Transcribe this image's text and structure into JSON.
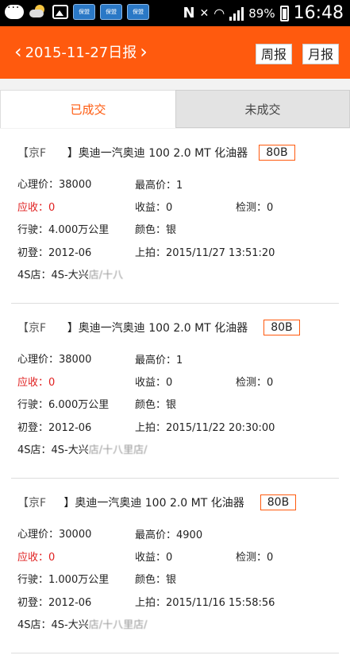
{
  "statusbar": {
    "battery": "89%",
    "time": "16:48",
    "apps": [
      "保盟",
      "保盟",
      "保盟"
    ]
  },
  "header": {
    "date": "2015-11-27日报",
    "weekly_label": "周报",
    "monthly_label": "月报"
  },
  "tabs": {
    "done": "已成交",
    "not_done": "未成交"
  },
  "cards": [
    {
      "plate": "【京F",
      "plate_tail": "】",
      "model": "奥迪一汽奥迪 100 2.0 MT 化油器",
      "badge": "80B",
      "psy_price": "心理价：38000",
      "max_price": "最高价：1",
      "receivable": "应收：0",
      "profit": "收益：0",
      "inspect": "检测：0",
      "mileage": "行驶：4.000万公里",
      "color": "颜色：银",
      "first_reg": "初登：2012-06",
      "auction": "上拍：2015/11/27 13:51:20",
      "store": "4S店：4S-大兴",
      "store_tail": "店/十八"
    },
    {
      "plate": "【京F",
      "plate_tail": "】",
      "model": "奥迪一汽奥迪 100 2.0 MT 化油器",
      "badge": "80B",
      "psy_price": "心理价：38000",
      "max_price": "最高价：1",
      "receivable": "应收：0",
      "profit": "收益：0",
      "inspect": "检测：0",
      "mileage": "行驶：6.000万公里",
      "color": "颜色：银",
      "first_reg": "初登：2012-06",
      "auction": "上拍：2015/11/22 20:30:00",
      "store": "4S店：4S-大兴",
      "store_tail": "店/十八里店/"
    },
    {
      "plate": "【京F",
      "plate_tail": "】",
      "model": "奥迪一汽奥迪 100 2.0 MT 化油器",
      "badge": "80B",
      "psy_price": "心理价：30000",
      "max_price": "最高价：4900",
      "receivable": "应收：0",
      "profit": "收益：0",
      "inspect": "检测：0",
      "mileage": "行驶：1.000万公里",
      "color": "颜色：银",
      "first_reg": "初登：2012-06",
      "auction": "上拍：2015/11/16 15:58:56",
      "store": "4S店：4S-大兴",
      "store_tail": "店/十八里店/"
    }
  ]
}
